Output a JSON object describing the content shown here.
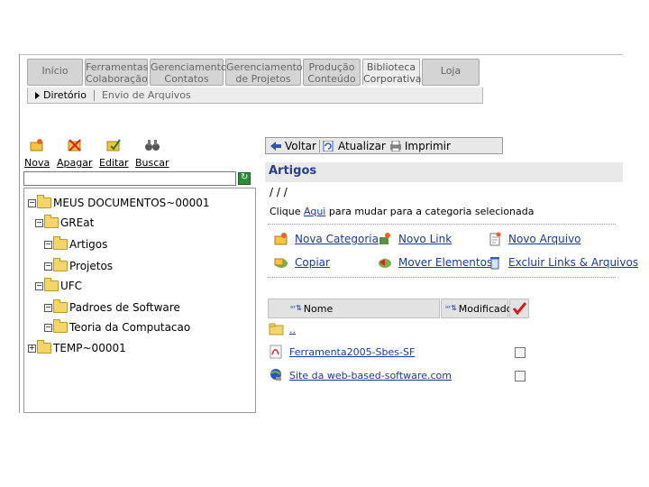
{
  "top_tabs": [
    {
      "line1": "Início",
      "line2": ""
    },
    {
      "line1": "Ferramentas",
      "line2": "Colaboração"
    },
    {
      "line1": "Gerenciamento",
      "line2": "Contatos"
    },
    {
      "line1": "Gerenciamento",
      "line2": "de Projetos"
    },
    {
      "line1": "Produção",
      "line2": "Conteúdo"
    },
    {
      "line1": "Biblioteca",
      "line2": "Corporativa"
    },
    {
      "line1": "Loja",
      "line2": ""
    }
  ],
  "subnav": {
    "directory": "Diretório",
    "upload": "Envio de Arquivos"
  },
  "left_toolbar": {
    "new": "Nova",
    "delete": "Apagar",
    "edit": "Editar",
    "search": "Buscar"
  },
  "tree": {
    "root": "MEUS DOCUMENTOS~00001",
    "great": "GREat",
    "artigos": "Artigos",
    "projetos": "Projetos",
    "ufc": "UFC",
    "padroes": "Padroes de Software",
    "teoria": "Teoria da Computacao",
    "temp": "TEMP~00001"
  },
  "right_toolbar": {
    "back": "Voltar",
    "refresh": "Atualizar",
    "print": "Imprimir"
  },
  "category": {
    "title": "Artigos",
    "path": "/ / /",
    "instruction_pre": "Clique",
    "instruction_link": "Aqui",
    "instruction_post": "para mudar para a categoria selecionada"
  },
  "actions": {
    "new_category": "Nova Categoria",
    "new_link": "Novo Link",
    "new_file": "Novo Arquivo",
    "copy": "Copiar",
    "move": "Mover Elementos",
    "delete_all": "Excluir Links & Arquivos"
  },
  "table": {
    "col_name": "Nome",
    "col_modified": "Modificado",
    "rows": [
      {
        "name": ".."
      },
      {
        "name": "Ferramenta2005-Sbes-SF"
      },
      {
        "name": "Site da web-based-software.com"
      }
    ]
  }
}
